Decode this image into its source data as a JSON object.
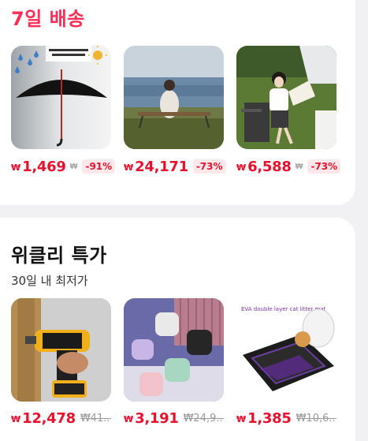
{
  "sections": {
    "delivery": {
      "title": "7일 배송",
      "items": [
        {
          "won": "₩",
          "price": "1,469",
          "mini_strike": "₩",
          "discount": "-91%",
          "image": "black umbrella with rain and sun graphic"
        },
        {
          "won": "₩",
          "price": "24,171",
          "discount": "-73%",
          "image": "woman sitting on camping chair by the sea"
        },
        {
          "won": "₩",
          "price": "6,588",
          "mini_strike": "₩",
          "discount": "-73%",
          "image": "woman reading magazine on camping chair"
        }
      ]
    },
    "weekly": {
      "title": "위클리 특가",
      "subtitle": "30일 내 최저가",
      "items": [
        {
          "won": "₩",
          "price": "12,478",
          "orig": "₩41...",
          "image": "cordless drill in hand"
        },
        {
          "won": "₩",
          "price": "3,191",
          "orig": "₩24,9...",
          "image": "wireless earbuds in pastel cases"
        },
        {
          "won": "₩",
          "price": "1,385",
          "orig": "₩10,6...",
          "image": "EVA double layer cat litter mat",
          "image_text": "EVA double layer cat litter mat"
        }
      ]
    }
  },
  "colors": {
    "accent": "#e8112d",
    "title_accent": "#ff2d55",
    "discount_bg": "#ffe8ea",
    "page_bg": "#f1f1f3"
  }
}
